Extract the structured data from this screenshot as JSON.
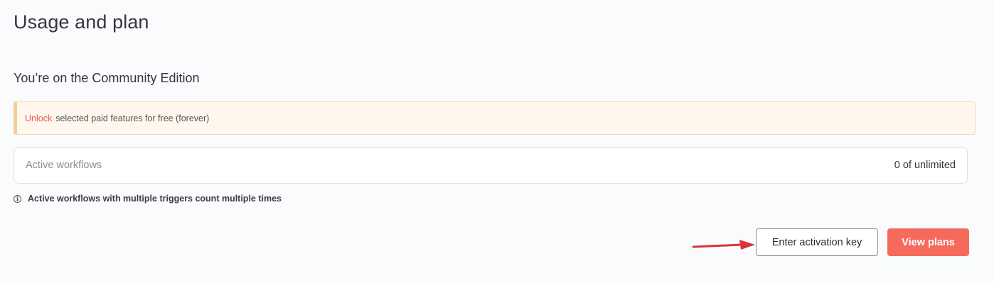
{
  "page": {
    "title": "Usage and plan"
  },
  "plan": {
    "heading": "You’re on the Community Edition"
  },
  "callout": {
    "link_label": "Unlock",
    "text": "selected paid features for free (forever)"
  },
  "usage": {
    "label": "Active workflows",
    "value": "0 of unlimited"
  },
  "info": {
    "icon": "info-icon",
    "text": "Active workflows with multiple triggers count multiple times"
  },
  "actions": {
    "activation_label": "Enter activation key",
    "plans_label": "View plans"
  },
  "colors": {
    "accent": "#f56a5b",
    "link": "#ea5b48",
    "callout_bg": "#fff6ed",
    "callout_border": "#f3cf95",
    "annotation_arrow": "#d9333f"
  }
}
